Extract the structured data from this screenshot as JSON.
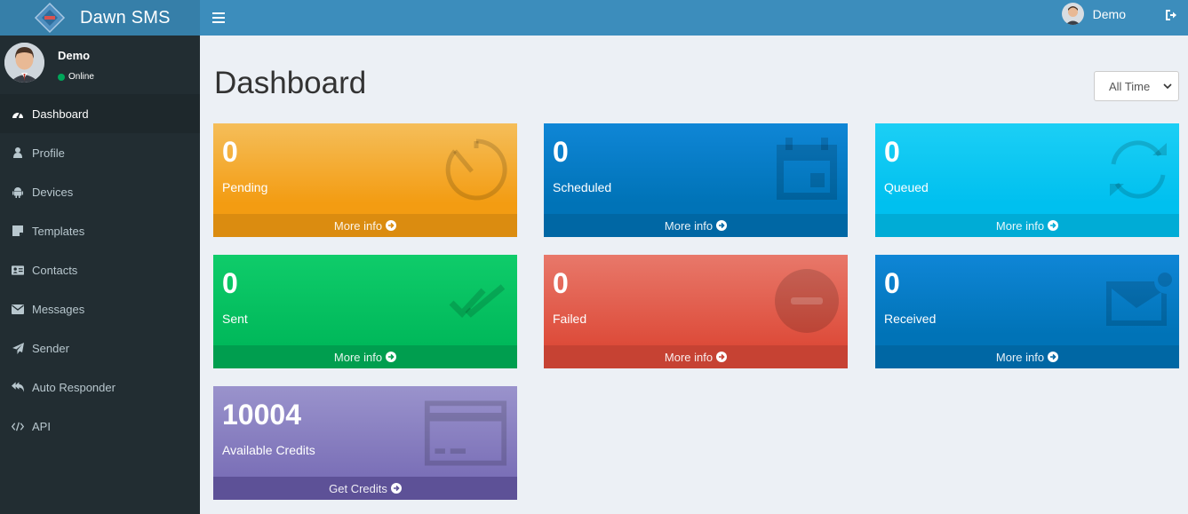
{
  "app": {
    "name": "Dawn SMS"
  },
  "header": {
    "user_name": "Demo"
  },
  "sidebar": {
    "user": {
      "name": "Demo",
      "status": "Online"
    },
    "items": [
      {
        "label": "Dashboard",
        "icon": "dashboard-icon",
        "active": true
      },
      {
        "label": "Profile",
        "icon": "user-icon"
      },
      {
        "label": "Devices",
        "icon": "android-icon"
      },
      {
        "label": "Templates",
        "icon": "sticky-note-icon"
      },
      {
        "label": "Contacts",
        "icon": "address-card-icon"
      },
      {
        "label": "Messages",
        "icon": "envelope-icon"
      },
      {
        "label": "Sender",
        "icon": "paper-plane-icon"
      },
      {
        "label": "Auto Responder",
        "icon": "reply-all-icon"
      },
      {
        "label": "API",
        "icon": "code-icon"
      }
    ]
  },
  "main": {
    "title": "Dashboard",
    "range": "All Time",
    "boxes": {
      "pending": {
        "value": "0",
        "label": "Pending",
        "link": "More info",
        "icon": "clock-icon",
        "color": "#f39c12"
      },
      "scheduled": {
        "value": "0",
        "label": "Scheduled",
        "link": "More info",
        "icon": "calendar-icon",
        "color": "#0073b7"
      },
      "queued": {
        "value": "0",
        "label": "Queued",
        "link": "More info",
        "icon": "refresh-icon",
        "color": "#00c0ef"
      },
      "sent": {
        "value": "0",
        "label": "Sent",
        "link": "More info",
        "icon": "double-check-icon",
        "color": "#00a65a"
      },
      "failed": {
        "value": "0",
        "label": "Failed",
        "link": "More info",
        "icon": "minus-circle-icon",
        "color": "#dd4b39"
      },
      "received": {
        "value": "0",
        "label": "Received",
        "link": "More info",
        "icon": "envelope-icon",
        "color": "#0073b7"
      },
      "credits": {
        "value": "10004",
        "label": "Available Credits",
        "link": "Get Credits",
        "icon": "credit-card-icon",
        "color": "#7a6fb7"
      }
    }
  }
}
